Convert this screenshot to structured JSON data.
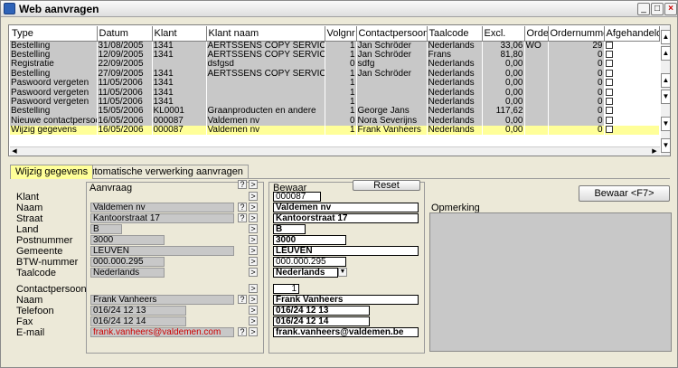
{
  "window": {
    "title": "Web aanvragen",
    "min": "_",
    "max": "□",
    "close": "×"
  },
  "grid": {
    "columns": [
      "Type",
      "Datum",
      "Klant",
      "Klant naam",
      "Volgnr",
      "Contactpersoon",
      "Taalcode",
      "Excl.",
      "Order",
      "Ordernummer",
      "Afgehandeld"
    ],
    "rows": [
      {
        "type": "Bestelling",
        "datum": "31/08/2005",
        "klant": "1341",
        "naam": "AERTSSENS COPY SERVICE",
        "volgnr": "1",
        "contact": "Jan Schröder",
        "taal": "Nederlands",
        "excl": "33,06",
        "order": "WO",
        "ordernr": "29"
      },
      {
        "type": "Bestelling",
        "datum": "12/09/2005",
        "klant": "1341",
        "naam": "AERTSSENS COPY SERVICE",
        "volgnr": "1",
        "contact": "Jan Schröder",
        "taal": "Frans",
        "excl": "81,80",
        "order": "",
        "ordernr": "0"
      },
      {
        "type": "Registratie",
        "datum": "22/09/2005",
        "klant": "",
        "naam": "dsfgsd",
        "volgnr": "0",
        "contact": "sdfg",
        "taal": "Nederlands",
        "excl": "0,00",
        "order": "",
        "ordernr": "0"
      },
      {
        "type": "Bestelling",
        "datum": "27/09/2005",
        "klant": "1341",
        "naam": "AERTSSENS COPY SERVICE",
        "volgnr": "1",
        "contact": "Jan Schröder",
        "taal": "Nederlands",
        "excl": "0,00",
        "order": "",
        "ordernr": "0"
      },
      {
        "type": "Paswoord vergeten",
        "datum": "11/05/2006",
        "klant": "1341",
        "naam": "",
        "volgnr": "1",
        "contact": "",
        "taal": "Nederlands",
        "excl": "0,00",
        "order": "",
        "ordernr": "0"
      },
      {
        "type": "Paswoord vergeten",
        "datum": "11/05/2006",
        "klant": "1341",
        "naam": "",
        "volgnr": "1",
        "contact": "",
        "taal": "Nederlands",
        "excl": "0,00",
        "order": "",
        "ordernr": "0"
      },
      {
        "type": "Paswoord vergeten",
        "datum": "11/05/2006",
        "klant": "1341",
        "naam": "",
        "volgnr": "1",
        "contact": "",
        "taal": "Nederlands",
        "excl": "0,00",
        "order": "",
        "ordernr": "0"
      },
      {
        "type": "Bestelling",
        "datum": "15/05/2006",
        "klant": "KL0001",
        "naam": "Graanproducten en andere",
        "volgnr": "1",
        "contact": "George Jans",
        "taal": "Nederlands",
        "excl": "117,62",
        "order": "",
        "ordernr": "0"
      },
      {
        "type": "Nieuwe contactpersoon",
        "datum": "16/05/2006",
        "klant": "000087",
        "naam": "Valdemen nv",
        "volgnr": "0",
        "contact": "Nora Severijns",
        "taal": "Nederlands",
        "excl": "0,00",
        "order": "",
        "ordernr": "0"
      },
      {
        "type": "Wijzig gegevens",
        "datum": "16/05/2006",
        "klant": "000087",
        "naam": "Valdemen nv",
        "volgnr": "1",
        "contact": "Frank Vanheers",
        "taal": "Nederlands",
        "excl": "0,00",
        "order": "",
        "ordernr": "0"
      }
    ]
  },
  "tabs": [
    "Wijzig gegevens",
    "Automatische verwerking aanvragen"
  ],
  "aanvraag": {
    "title": "Aanvraag",
    "naam": "Valdemen nv",
    "straat": "Kantoorstraat 17",
    "land": "B",
    "postnummer": "3000",
    "gemeente": "LEUVEN",
    "btw": "000.000.295",
    "taalcode": "Nederlands",
    "cp_naam": "Frank Vanheers",
    "telefoon": "016/24 12 13",
    "fax": "016/24 12 14",
    "email": "frank.vanheers@valdemen.com"
  },
  "labels": {
    "klant": "Klant",
    "naam": "Naam",
    "straat": "Straat",
    "land": "Land",
    "postnummer": "Postnummer",
    "gemeente": "Gemeente",
    "btw": "BTW-nummer",
    "taalcode": "Taalcode",
    "contactpersoon": "Contactpersoon",
    "cp_naam": "Naam",
    "telefoon": "Telefoon",
    "fax": "Fax",
    "email": "E-mail"
  },
  "bewaar": {
    "title": "Bewaar",
    "reset": "Reset",
    "klant": "000087",
    "naam": "Valdemen nv",
    "straat": "Kantoorstraat 17",
    "land": "B",
    "postnummer": "3000",
    "gemeente": "LEUVEN",
    "btw": "000.000.295",
    "taalcode": "Nederlands",
    "cp_nr": "1",
    "cp_naam": "Frank Vanheers",
    "telefoon": "016/24 12 13",
    "fax": "016/24 12 14",
    "email": "frank.vanheers@valdemen.be"
  },
  "opmerking": {
    "label": "Opmerking",
    "button": "Bewaar <F7>"
  },
  "colors": {
    "selected": "#ffff99",
    "cell": "#c8c8c8",
    "email": "#cc0000"
  }
}
